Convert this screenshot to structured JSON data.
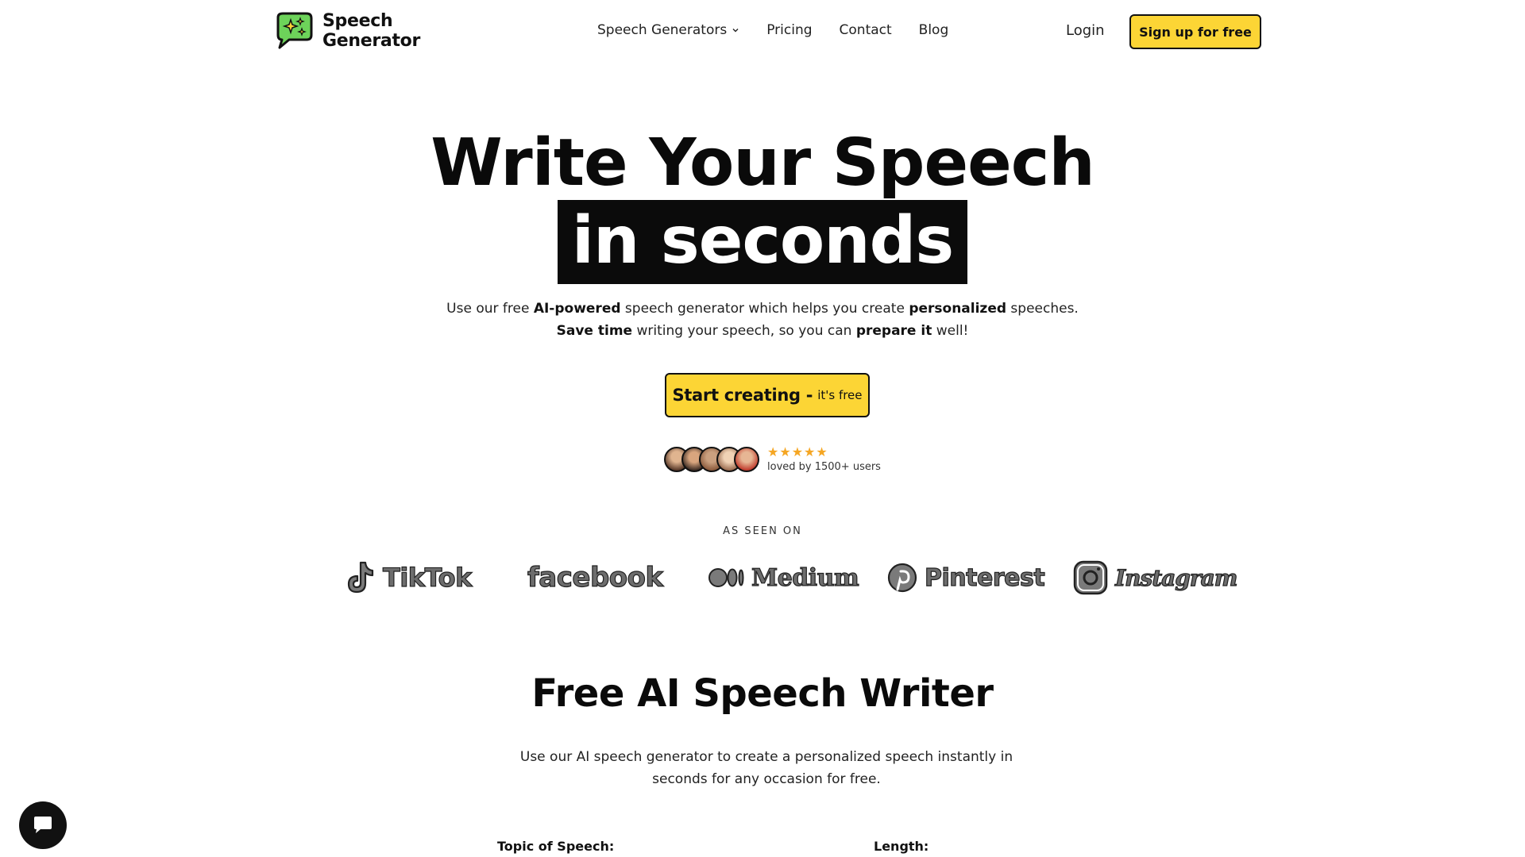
{
  "header": {
    "logo_line1": "Speech",
    "logo_line2": "Generator",
    "nav": [
      "Speech Generators",
      "Pricing",
      "Contact",
      "Blog"
    ],
    "login": "Login",
    "signup": "Sign up for free"
  },
  "hero": {
    "title_line1": "Write Your Speech",
    "title_line2": "in seconds",
    "subtitle_1a": "Use our free ",
    "subtitle_1b": "AI-powered",
    "subtitle_1c": " speech generator which helps you create ",
    "subtitle_1d": "personalized",
    "subtitle_1e": " speeches.",
    "subtitle_2a": "Save time",
    "subtitle_2b": " writing your speech, so you can ",
    "subtitle_2c": "prepare it",
    "subtitle_2d": " well!",
    "cta_main": "Start creating -",
    "cta_sub": "it's free",
    "rating_stars": "★★★★★",
    "loved_by": "loved by 1500+ users"
  },
  "seen_on": {
    "label": "AS SEEN ON",
    "brands": [
      "TikTok",
      "facebook",
      "Medium",
      "Pinterest",
      "Instagram"
    ]
  },
  "section": {
    "title": "Free AI Speech Writer",
    "description": "Use our AI speech generator to create a personalized speech instantly in seconds for any occasion for free.",
    "topic_label": "Topic of Speech:",
    "length_label": "Length:"
  },
  "colors": {
    "accent_yellow": "#fcd535",
    "logo_green": "#6dd35a",
    "star": "#f5a623"
  },
  "icons": [
    "speech-bubble-logo-icon",
    "chevron-down-icon",
    "tiktok-icon",
    "medium-icon",
    "pinterest-icon",
    "instagram-icon",
    "chat-icon"
  ]
}
